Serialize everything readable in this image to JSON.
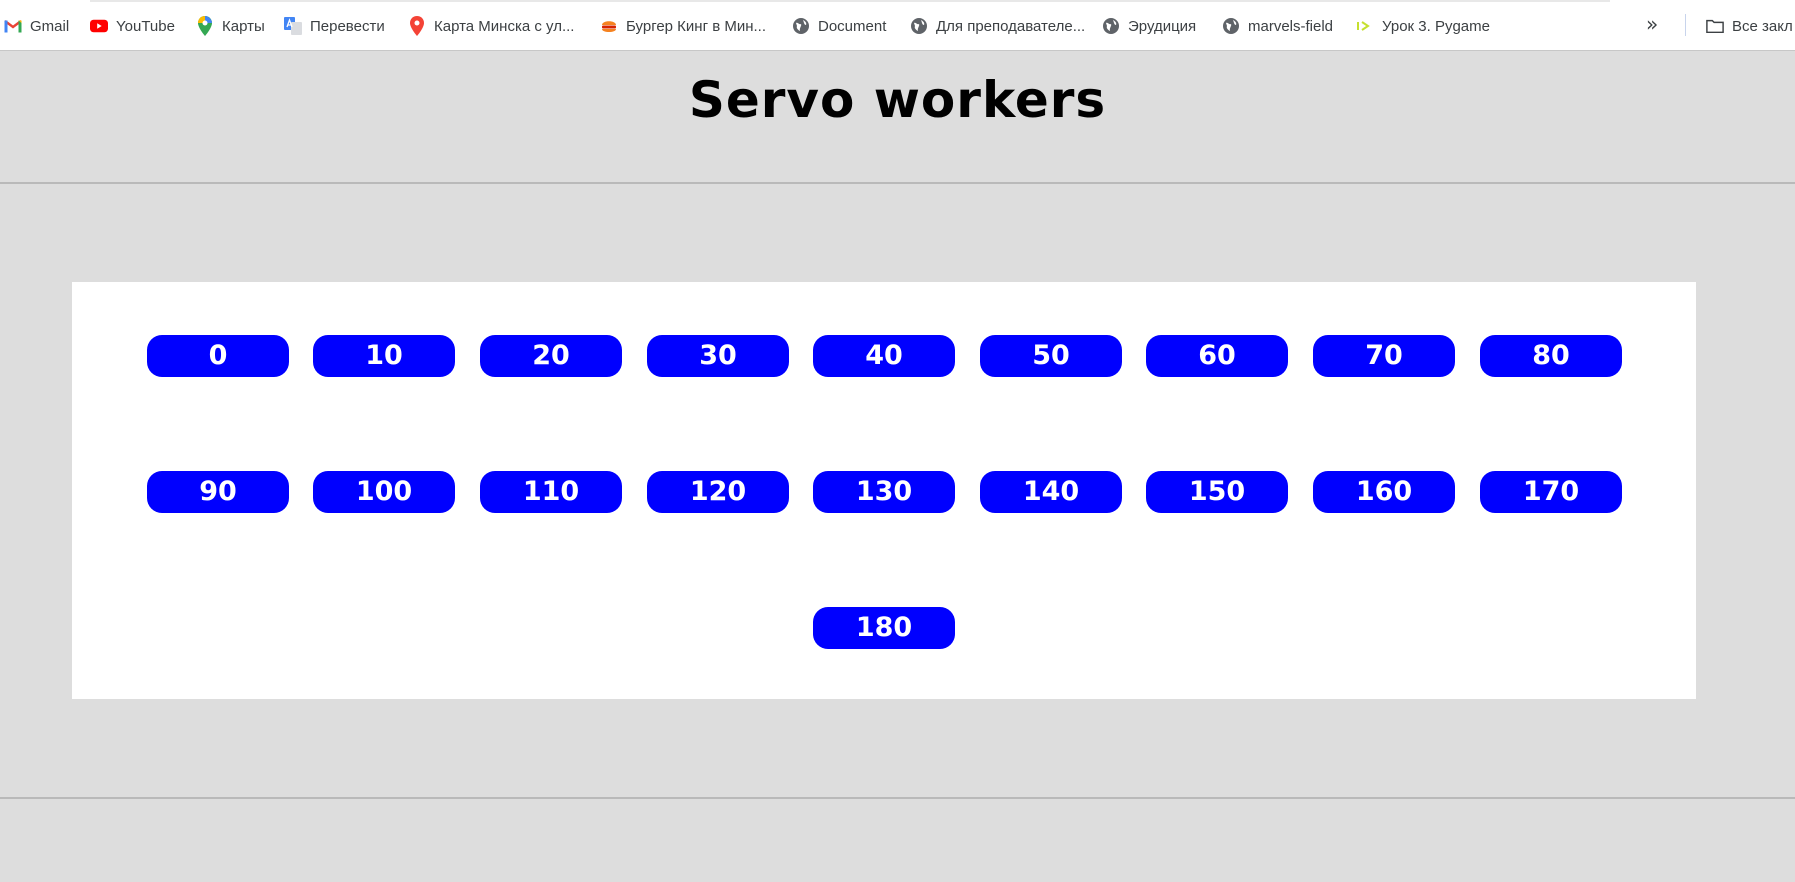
{
  "bookmarks": [
    {
      "label": "Gmail",
      "icon": "gmail-icon"
    },
    {
      "label": "YouTube",
      "icon": "youtube-icon"
    },
    {
      "label": "Карты",
      "icon": "maps-pin-icon"
    },
    {
      "label": "Перевести",
      "icon": "translate-icon"
    },
    {
      "label": "Карта Минска с ул...",
      "icon": "map-marker-icon"
    },
    {
      "label": "Бургер Кинг в Мин...",
      "icon": "burger-king-icon"
    },
    {
      "label": "Document",
      "icon": "globe-icon"
    },
    {
      "label": "Для преподавателе...",
      "icon": "globe-icon"
    },
    {
      "label": "Эрудиция",
      "icon": "globe-icon"
    },
    {
      "label": "marvels-field",
      "icon": "globe-icon"
    },
    {
      "label": "Урок 3. Pygame",
      "icon": "code-arrow-icon"
    }
  ],
  "bookmarks_overflow": "»",
  "all_bookmarks_label": "Все закл",
  "page": {
    "title": "Servo workers"
  },
  "angles": [
    "0",
    "10",
    "20",
    "30",
    "40",
    "50",
    "60",
    "70",
    "80",
    "90",
    "100",
    "110",
    "120",
    "130",
    "140",
    "150",
    "160",
    "170",
    "180"
  ],
  "colors": {
    "background": "#dddddd",
    "panel": "#ffffff",
    "button": "#0000ff",
    "button_text": "#ffffff"
  }
}
